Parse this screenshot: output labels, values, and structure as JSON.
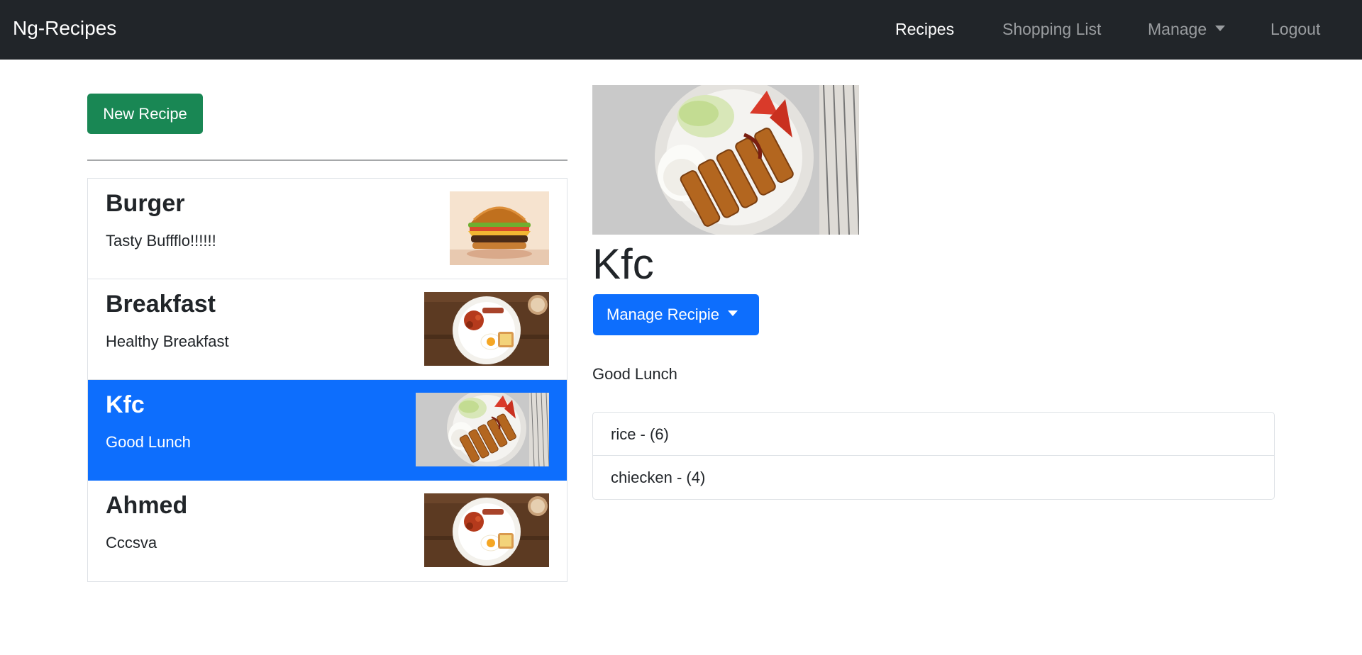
{
  "navbar": {
    "brand": "Ng-Recipes",
    "links": {
      "recipes": "Recipes",
      "shopping_list": "Shopping List",
      "manage": "Manage",
      "logout": "Logout"
    }
  },
  "recipes": {
    "new_button": "New Recipe",
    "items": [
      {
        "name": "Burger",
        "description": "Tasty Buffflo!!!!!!",
        "image": "burger-image"
      },
      {
        "name": "Breakfast",
        "description": "Healthy Breakfast",
        "image": "breakfast-image"
      },
      {
        "name": "Kfc",
        "description": "Good Lunch",
        "image": "chicken-cutlet-image",
        "active": true
      },
      {
        "name": "Ahmed",
        "description": "Cccsva",
        "image": "breakfast-image"
      }
    ]
  },
  "detail": {
    "image": "chicken-cutlet-image",
    "title": "Kfc",
    "manage_button": "Manage Recipie",
    "description": "Good Lunch",
    "ingredients": [
      {
        "text": "rice - (6)"
      },
      {
        "text": "chiecken - (4)"
      }
    ]
  },
  "colors": {
    "navbar": "#212529",
    "primary": "#0d6efd",
    "success": "#198754"
  }
}
